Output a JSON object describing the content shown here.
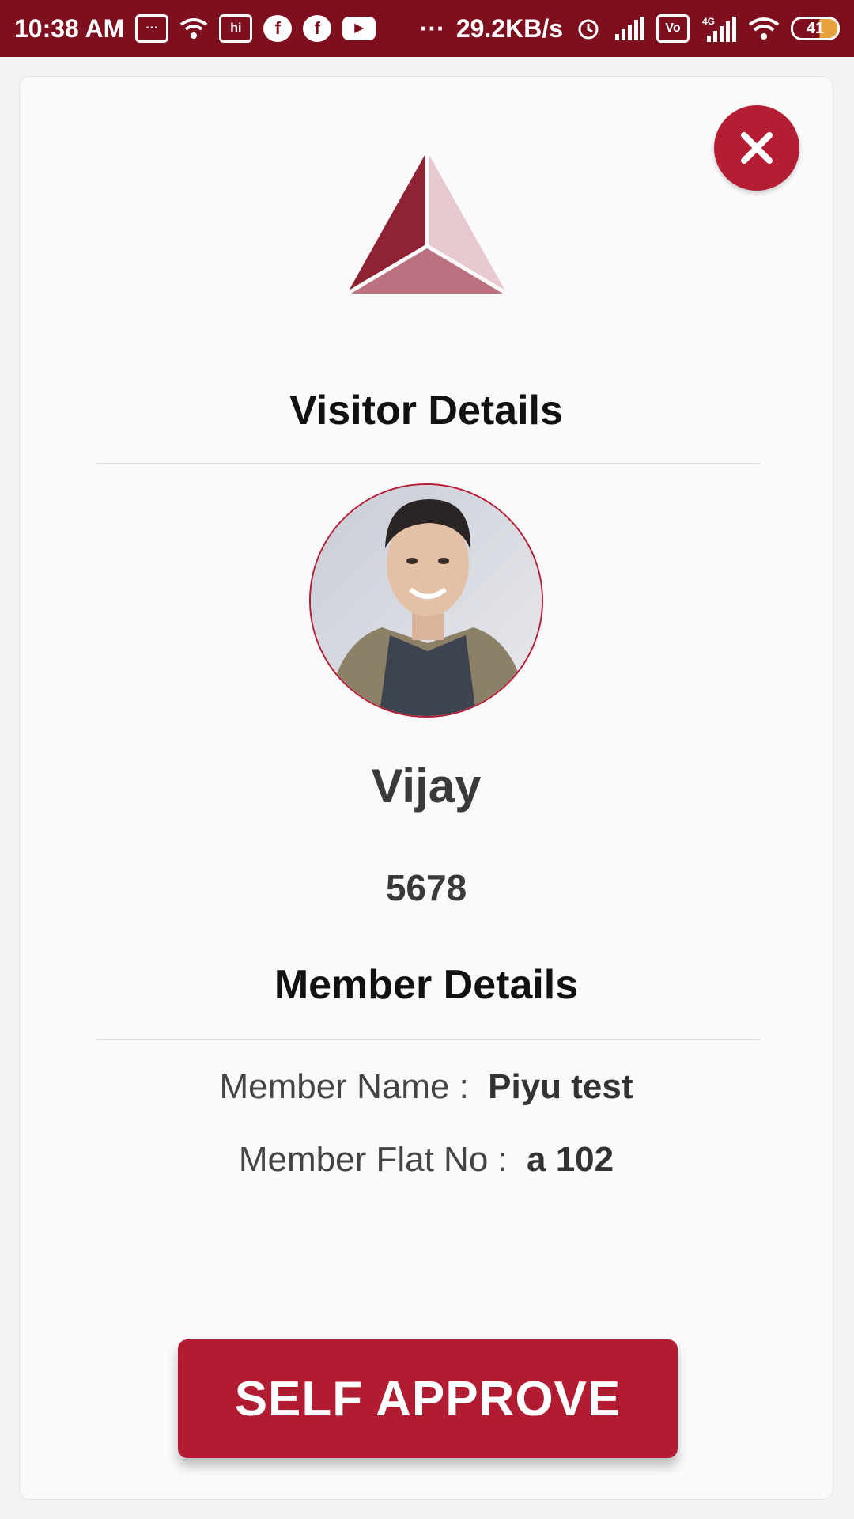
{
  "status_bar": {
    "time": "10:38 AM",
    "net_speed": "29.2KB/s",
    "battery": "41",
    "dots": "···",
    "icons": [
      "message-icon",
      "wifi-call-icon",
      "hike-icon",
      "facebook-icon",
      "facebook-icon",
      "youtube-icon",
      "alarm-icon",
      "signal-icon",
      "volte-icon",
      "signal-4g-icon",
      "wifi-icon",
      "battery-icon"
    ]
  },
  "colors": {
    "brand": "#b21c33",
    "status_bar": "#7e0f1f"
  },
  "visitor": {
    "section_title": "Visitor Details",
    "name": "Vijay",
    "code": "5678"
  },
  "member": {
    "section_title": "Member Details",
    "name_label": "Member Name :",
    "name_value": "Piyu test",
    "flat_label": "Member Flat No :",
    "flat_value": "a 102"
  },
  "actions": {
    "approve_label": "SELF APPROVE"
  }
}
